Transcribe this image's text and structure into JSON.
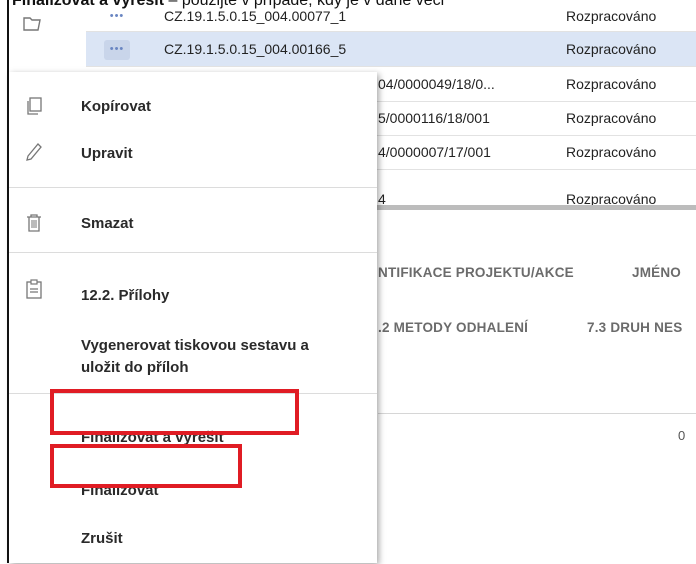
{
  "caption": {
    "bold_part": "Finalizovat a vyřešit",
    "rest": " – použijte v případě, kdy je v dané věci"
  },
  "table": {
    "rows": [
      {
        "code": "CZ.19.1.5.0.15_004.00077_1",
        "status": "Rozpracováno"
      },
      {
        "code": "CZ.19.1.5.0.15_004.00166_5",
        "status": "Rozpracováno"
      },
      {
        "code": "04/0000049/18/0...",
        "status": "Rozpracováno"
      },
      {
        "code": "5/0000116/18/001",
        "status": "Rozpracováno"
      },
      {
        "code": "4/0000007/17/001",
        "status": "Rozpracováno"
      },
      {
        "code": "4",
        "status": "Rozpracováno"
      }
    ],
    "row_dots": "•••"
  },
  "tabs": {
    "row1": [
      "NTIFIKACE PROJEKTU/AKCE",
      "JMÉNO"
    ],
    "row2": [
      ".2 METODY ODHALENÍ",
      "7.3 DRUH NES"
    ]
  },
  "chart": {
    "zero_label": "0"
  },
  "menu": {
    "kopirovat": "Kopírovat",
    "upravit": "Upravit",
    "smazat": "Smazat",
    "prilohy": "12.2. Přílohy",
    "vygenerovat_line1": "Vygenerovat tiskovou sestavu a",
    "vygenerovat_line2": "uložit do příloh",
    "finalizovat_vyresit": "Finalizovat a vyřešit",
    "finalizovat": "Finalizovat",
    "zrusit": "Zrušit"
  },
  "colors": {
    "selected_row": "#dbe5f5",
    "highlight": "#e01c24",
    "dots_text": "#6a86c2"
  },
  "icons": [
    "folder-icon",
    "copy-icon",
    "pencil-icon",
    "trash-icon",
    "clipboard-icon"
  ]
}
